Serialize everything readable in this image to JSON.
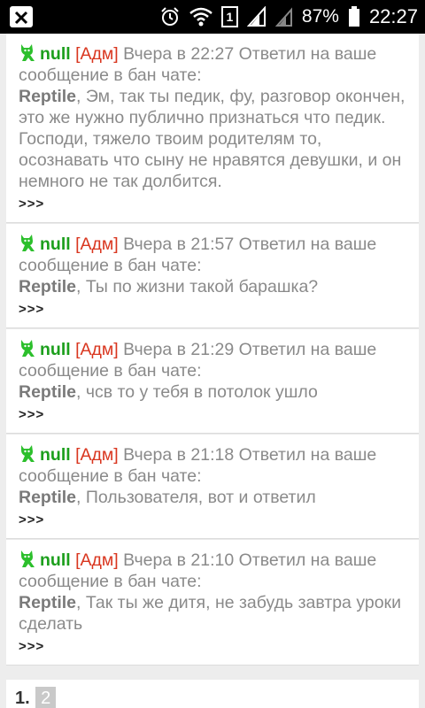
{
  "status_bar": {
    "sim": "1",
    "battery": "87%",
    "time": "22:27"
  },
  "messages": [
    {
      "user": "null",
      "role": "[Адм]",
      "meta": "Вчера в 22:27 Ответил на ваше сообщение в бан чате:",
      "recipient": "Reptile",
      "text": ", Эм, так ты педик, фу, разговор окончен, это же нужно публично признаться что педик. Господи, тяжело твоим родителям то, осознавать что сыну не нравятся девушки, и он немного не так долбится.",
      "more": ">>>"
    },
    {
      "user": "null",
      "role": "[Адм]",
      "meta": "Вчера в 21:57 Ответил на ваше сообщение в бан чате:",
      "recipient": "Reptile",
      "text": ", Ты по жизни такой барашка?",
      "more": ">>>"
    },
    {
      "user": "null",
      "role": "[Адм]",
      "meta": "Вчера в 21:29 Ответил на ваше сообщение в бан чате:",
      "recipient": "Reptile",
      "text": ", чсв то у тебя в потолок ушло",
      "more": ">>>"
    },
    {
      "user": "null",
      "role": "[Адм]",
      "meta": "Вчера в 21:18 Ответил на ваше сообщение в бан чате:",
      "recipient": "Reptile",
      "text": ", Пользователя, вот и ответил",
      "more": ">>>"
    },
    {
      "user": "null",
      "role": "[Адм]",
      "meta": "Вчера в 21:10 Ответил на ваше сообщение в бан чате:",
      "recipient": "Reptile",
      "text": ", Так ты же дитя, не забудь завтра уроки сделать",
      "more": ">>>"
    }
  ],
  "pagination": {
    "current": "1.",
    "next": "2"
  },
  "colors": {
    "username": "#1c9f1c",
    "role": "#d9361f",
    "meta": "#8a8a8a"
  }
}
